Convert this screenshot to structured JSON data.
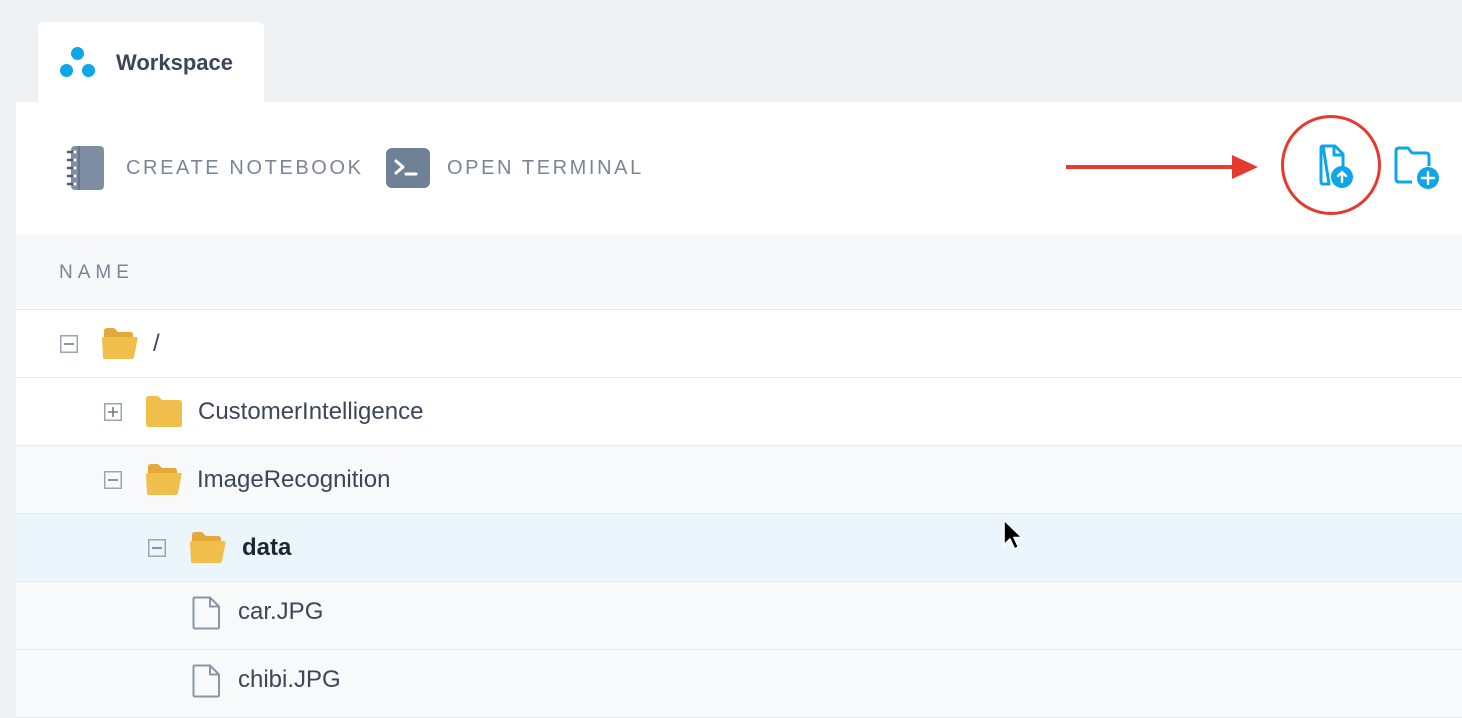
{
  "tab": {
    "label": "Workspace",
    "logo_icon": "three-dots-logo"
  },
  "toolbar": {
    "create_notebook_label": "CREATE NOTEBOOK",
    "open_terminal_label": "OPEN TERMINAL",
    "upload_file_icon": "upload-file-icon",
    "new_folder_icon": "new-folder-icon"
  },
  "table": {
    "column_name": "NAME"
  },
  "tree": {
    "rows": [
      {
        "label": "/",
        "type": "folder",
        "state": "expanded"
      },
      {
        "label": "CustomerIntelligence",
        "type": "folder",
        "state": "collapsed"
      },
      {
        "label": "ImageRecognition",
        "type": "folder",
        "state": "expanded"
      },
      {
        "label": "data",
        "type": "folder",
        "state": "expanded",
        "selected": true
      },
      {
        "label": "car.JPG",
        "type": "file"
      },
      {
        "label": "chibi.JPG",
        "type": "file"
      }
    ]
  },
  "colors": {
    "accent": "#0ea5e9",
    "folder": "#f0be4a",
    "annotation": "#e63a2e",
    "selected_row": "#eaf6fb",
    "alt_row": "#f7f9fb"
  }
}
